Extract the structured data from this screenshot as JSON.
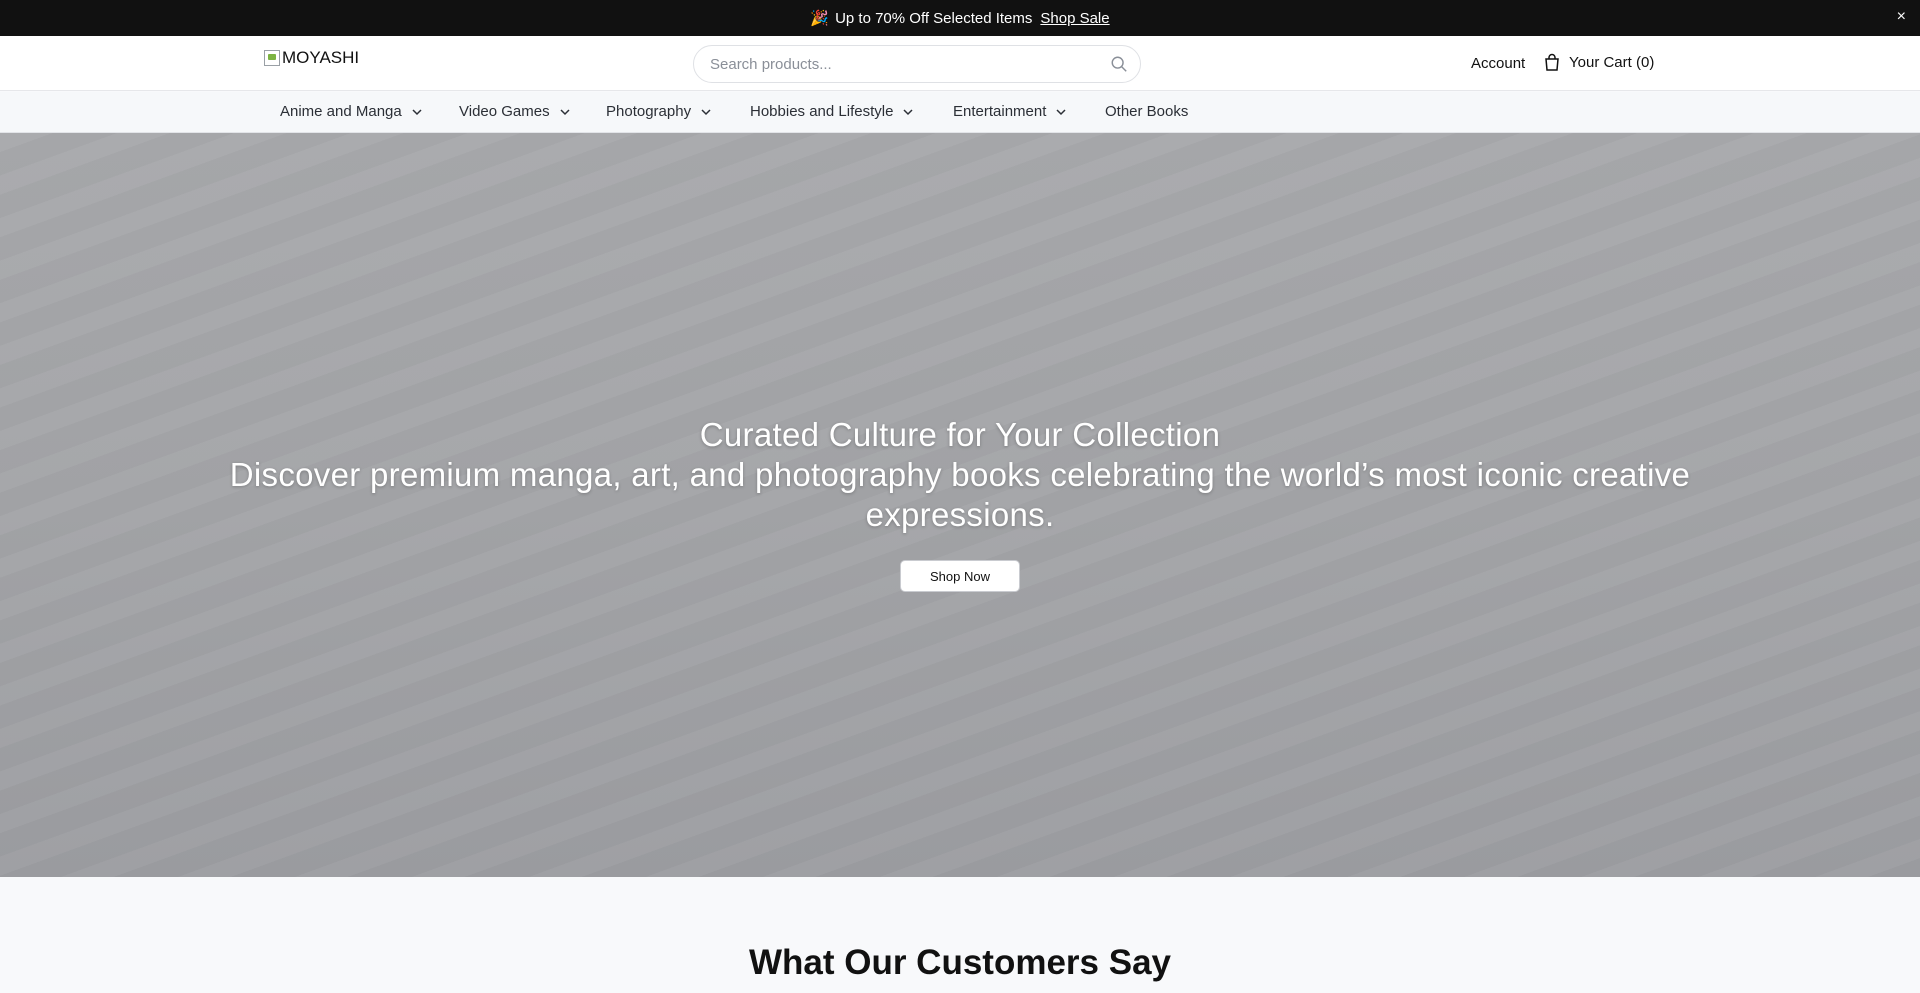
{
  "announcement": {
    "emoji": "🎉",
    "text": "Up to 70% Off Selected Items",
    "link": "Shop Sale",
    "close": "×"
  },
  "header": {
    "logo_alt": "MOYASHI",
    "search_placeholder": "Search products...",
    "account": "Account",
    "cart": "Your Cart (0)"
  },
  "nav": {
    "items": [
      {
        "label": "Anime and Manga",
        "dropdown": true
      },
      {
        "label": "Video Games",
        "dropdown": true
      },
      {
        "label": "Photography",
        "dropdown": true
      },
      {
        "label": "Hobbies and Lifestyle",
        "dropdown": true
      },
      {
        "label": "Entertainment",
        "dropdown": true
      },
      {
        "label": "Other Books",
        "dropdown": false
      }
    ]
  },
  "hero": {
    "title": "Curated Culture for Your Collection",
    "subtitle_line1": "Discover premium manga, art, and photography books celebrating the world’s most iconic creative",
    "subtitle_line2": "expressions.",
    "cta": "Shop Now"
  },
  "testimonials": {
    "heading": "What Our Customers Say"
  }
}
